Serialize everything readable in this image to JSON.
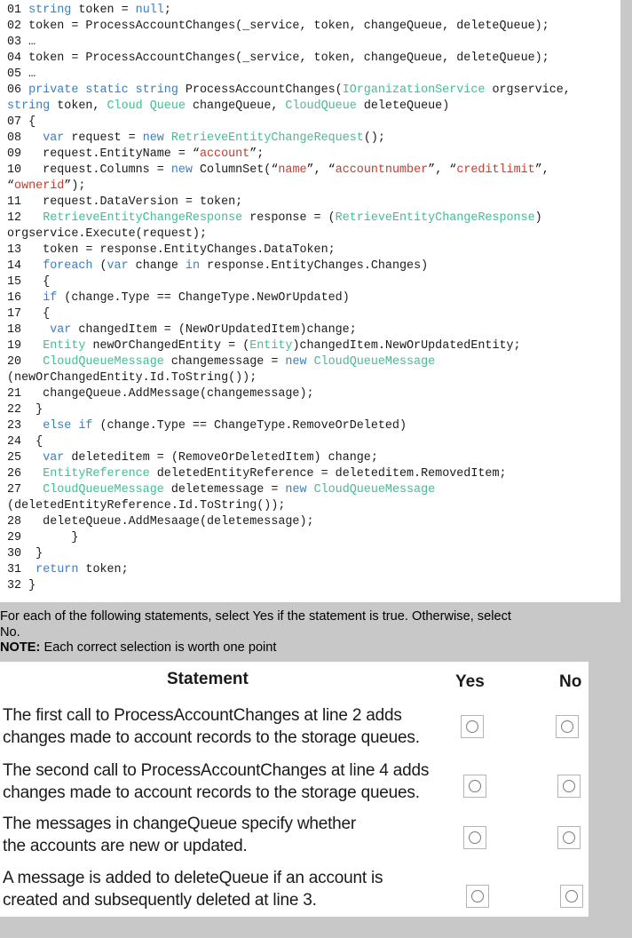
{
  "code_lines": [
    [
      {
        "t": "01 "
      },
      {
        "t": "string",
        "c": "kw"
      },
      {
        "t": " token = "
      },
      {
        "t": "null",
        "c": "kw"
      },
      {
        "t": ";"
      }
    ],
    [
      {
        "t": "02 token = ProcessAccountChanges(_service, token, changeQueue, deleteQueue);"
      }
    ],
    [
      {
        "t": "03 …"
      }
    ],
    [
      {
        "t": "04 token = ProcessAccountChanges(_service, token, changeQueue, deleteQueue);"
      }
    ],
    [
      {
        "t": "05 …"
      }
    ],
    [
      {
        "t": "06 "
      },
      {
        "t": "private static string",
        "c": "kw"
      },
      {
        "t": " ProcessAccountChanges("
      },
      {
        "t": "IOrganizationService",
        "c": "tp"
      },
      {
        "t": " orgservice,"
      }
    ],
    [
      {
        "t": "string",
        "c": "kw"
      },
      {
        "t": " token, "
      },
      {
        "t": "Cloud Queue",
        "c": "tp"
      },
      {
        "t": " changeQueue, "
      },
      {
        "t": "CloudQueue",
        "c": "tp"
      },
      {
        "t": " deleteQueue)"
      }
    ],
    [
      {
        "t": "07 {"
      }
    ],
    [
      {
        "t": "08   "
      },
      {
        "t": "var",
        "c": "kw"
      },
      {
        "t": " request = "
      },
      {
        "t": "new",
        "c": "kw"
      },
      {
        "t": " "
      },
      {
        "t": "RetrieveEntityChangeRequest",
        "c": "tp"
      },
      {
        "t": "();"
      }
    ],
    [
      {
        "t": "09   request.EntityName = “"
      },
      {
        "t": "account",
        "c": "st"
      },
      {
        "t": "”;"
      }
    ],
    [
      {
        "t": "10   request.Columns = "
      },
      {
        "t": "new",
        "c": "kw"
      },
      {
        "t": " ColumnSet(“"
      },
      {
        "t": "name",
        "c": "st"
      },
      {
        "t": "”, “"
      },
      {
        "t": "accountnumber",
        "c": "st"
      },
      {
        "t": "”, “"
      },
      {
        "t": "creditlimit",
        "c": "st"
      },
      {
        "t": "”,"
      }
    ],
    [
      {
        "t": "“"
      },
      {
        "t": "ownerid",
        "c": "st"
      },
      {
        "t": "”);"
      }
    ],
    [
      {
        "t": "11   request.DataVersion = token;"
      }
    ],
    [
      {
        "t": "12   "
      },
      {
        "t": "RetrieveEntityChangeResponse",
        "c": "tp"
      },
      {
        "t": " response = ("
      },
      {
        "t": "RetrieveEntityChangeResponse",
        "c": "tp"
      },
      {
        "t": ")"
      }
    ],
    [
      {
        "t": "orgservice.Execute(request);"
      }
    ],
    [
      {
        "t": "13   token = response.EntityChanges.DataToken;"
      }
    ],
    [
      {
        "t": "14   "
      },
      {
        "t": "foreach",
        "c": "kw"
      },
      {
        "t": " ("
      },
      {
        "t": "var",
        "c": "kw"
      },
      {
        "t": " change "
      },
      {
        "t": "in",
        "c": "kw"
      },
      {
        "t": " response.EntityChanges.Changes)"
      }
    ],
    [
      {
        "t": "15   {"
      }
    ],
    [
      {
        "t": "16   "
      },
      {
        "t": "if",
        "c": "kw"
      },
      {
        "t": " (change.Type == ChangeType.NewOrUpdated)"
      }
    ],
    [
      {
        "t": "17   {"
      }
    ],
    [
      {
        "t": "18    "
      },
      {
        "t": "var",
        "c": "kw"
      },
      {
        "t": " changedItem = (NewOrUpdatedItem)change;"
      }
    ],
    [
      {
        "t": "19   "
      },
      {
        "t": "Entity",
        "c": "tp"
      },
      {
        "t": " newOrChangedEntity = ("
      },
      {
        "t": "Entity",
        "c": "tp"
      },
      {
        "t": ")changedItem.NewOrUpdatedEntity;"
      }
    ],
    [
      {
        "t": "20   "
      },
      {
        "t": "CloudQueueMessage",
        "c": "tp"
      },
      {
        "t": " changemessage = "
      },
      {
        "t": "new",
        "c": "kw"
      },
      {
        "t": " "
      },
      {
        "t": "CloudQueueMessage",
        "c": "tp"
      }
    ],
    [
      {
        "t": "(newOrChangedEntity.Id.ToString());"
      }
    ],
    [
      {
        "t": "21   changeQueue.AddMessage(changemessage);"
      }
    ],
    [
      {
        "t": "22  }"
      }
    ],
    [
      {
        "t": "23   "
      },
      {
        "t": "else if",
        "c": "kw"
      },
      {
        "t": " (change.Type == ChangeType.RemoveOrDeleted)"
      }
    ],
    [
      {
        "t": "24  {"
      }
    ],
    [
      {
        "t": "25   "
      },
      {
        "t": "var",
        "c": "kw"
      },
      {
        "t": " deleteditem = (RemoveOrDeletedItem) change;"
      }
    ],
    [
      {
        "t": "26   "
      },
      {
        "t": "EntityReference",
        "c": "tp"
      },
      {
        "t": " deletedEntityReference = deleteditem.RemovedItem;"
      }
    ],
    [
      {
        "t": "27   "
      },
      {
        "t": "CloudQueueMessage",
        "c": "tp"
      },
      {
        "t": " deletemessage = "
      },
      {
        "t": "new",
        "c": "kw"
      },
      {
        "t": " "
      },
      {
        "t": "CloudQueueMessage",
        "c": "tp"
      }
    ],
    [
      {
        "t": "(deletedEntityReference.Id.ToString());"
      }
    ],
    [
      {
        "t": "28   deleteQueue.AddMesaage(deletemessage);"
      }
    ],
    [
      {
        "t": "29       }"
      }
    ],
    [
      {
        "t": "30  }"
      }
    ],
    [
      {
        "t": "31  "
      },
      {
        "t": "return",
        "c": "kw"
      },
      {
        "t": " token;"
      }
    ],
    [
      {
        "t": "32 }"
      }
    ]
  ],
  "instructions": {
    "line1": "For each of the following statements, select Yes if the statement is true. Otherwise, select",
    "line2": "No.",
    "note_label": "NOTE:",
    "note_text": " Each correct selection is worth one point"
  },
  "table": {
    "header_statement": "Statement",
    "header_yes": "Yes",
    "header_no": "No",
    "rows": [
      {
        "line1": "The first call to ProcessAccountChanges at line 2 adds",
        "line2": "changes made to account records to the storage queues."
      },
      {
        "line1": "The second call to ProcessAccountChanges at line 4 adds",
        "line2": "changes made to account records to the storage queues."
      },
      {
        "line1": "The messages in changeQueue specify whether",
        "line2": "the accounts are new or updated."
      },
      {
        "line1": "A message is added to deleteQueue if an account is",
        "line2": "created and subsequently deleted at line 3."
      }
    ]
  },
  "colors": {
    "keyword": "#3a7ec0",
    "type": "#3fbf8f",
    "string": "#c83a2a"
  }
}
